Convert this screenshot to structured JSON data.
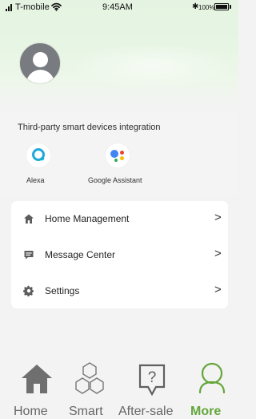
{
  "status_bar": {
    "carrier": "T-mobile",
    "time": "9:45AM",
    "battery_text": "100%"
  },
  "profile": {
    "avatar_icon": "user-avatar-icon"
  },
  "integration": {
    "title": "Third-party smart devices integration",
    "services": [
      {
        "label": "Alexa",
        "icon": "alexa-icon",
        "color": "#1EA9D8"
      },
      {
        "label": "Google Assistant",
        "icon": "google-assistant-icon",
        "colors": [
          "#4285F4",
          "#EA4335",
          "#FBBC05",
          "#34A853"
        ]
      }
    ]
  },
  "menu": {
    "items": [
      {
        "label": "Home Management",
        "icon": "home-icon",
        "chevron": ">"
      },
      {
        "label": "Message Center",
        "icon": "message-icon",
        "chevron": ">"
      },
      {
        "label": "Settings",
        "icon": "gear-icon",
        "chevron": ">"
      }
    ]
  },
  "bottom_nav": {
    "items": [
      {
        "label": "Home",
        "icon": "home-icon",
        "active": false
      },
      {
        "label": "Smart",
        "icon": "hexagon-icon",
        "active": false
      },
      {
        "label": "After-sale",
        "icon": "question-message-icon",
        "active": false
      },
      {
        "label": "More",
        "icon": "user-icon",
        "active": true
      }
    ]
  },
  "colors": {
    "header_green": "#E5F3E2",
    "background": "#F3F3F3",
    "card": "#FFFFFF",
    "text": "#222222",
    "muted_nav": "#666666",
    "active_nav": "#64A63B"
  }
}
